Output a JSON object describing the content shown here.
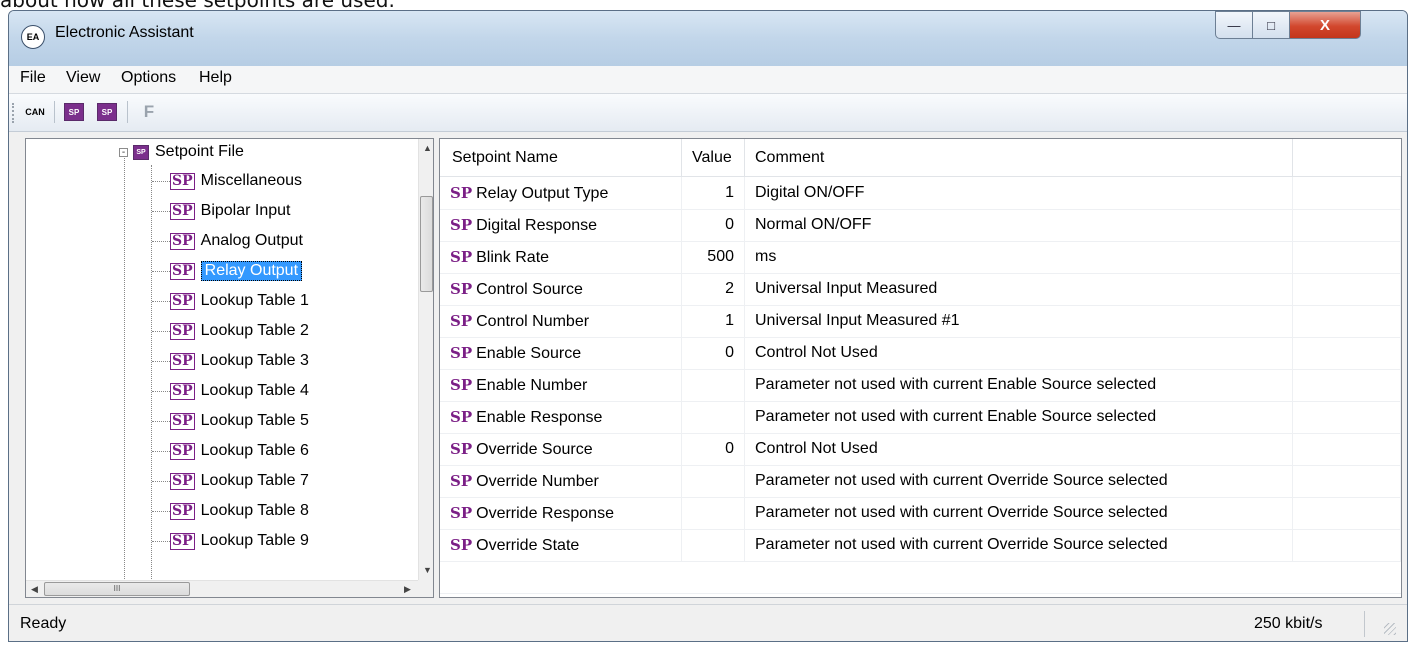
{
  "caption": "about how all these setpoints are used.",
  "window": {
    "title": "Electronic Assistant",
    "app_icon": "EA",
    "controls": {
      "minimize": "—",
      "maximize": "□",
      "close": "X"
    }
  },
  "menu": [
    "File",
    "View",
    "Options",
    "Help"
  ],
  "toolbar": {
    "can_label": "CAN",
    "sp1_label": "SP",
    "sp2_label": "SP",
    "f_label": "F",
    "icons": [
      "can-connect-icon",
      "open-setpoint-file-icon",
      "save-setpoint-file-icon",
      "flash-icon"
    ]
  },
  "tree": {
    "root": {
      "label": "Setpoint File",
      "expander": "-",
      "icon": "SP"
    },
    "sp_icon_label": "SP",
    "items": [
      {
        "label": "Miscellaneous"
      },
      {
        "label": "Bipolar Input"
      },
      {
        "label": "Analog Output"
      },
      {
        "label": "Relay Output",
        "selected": true
      },
      {
        "label": "Lookup Table 1"
      },
      {
        "label": "Lookup Table 2"
      },
      {
        "label": "Lookup Table 3"
      },
      {
        "label": "Lookup Table 4"
      },
      {
        "label": "Lookup Table 5"
      },
      {
        "label": "Lookup Table 6"
      },
      {
        "label": "Lookup Table 7"
      },
      {
        "label": "Lookup Table 8"
      },
      {
        "label": "Lookup Table 9"
      }
    ],
    "hscroll_grip": "III"
  },
  "grid": {
    "sp_tag": "SP",
    "headers": {
      "name": "Setpoint Name",
      "value": "Value",
      "comment": "Comment"
    },
    "rows": [
      {
        "name": "Relay Output Type",
        "value": "1",
        "comment": "Digital ON/OFF"
      },
      {
        "name": "Digital Response",
        "value": "0",
        "comment": "Normal ON/OFF"
      },
      {
        "name": "Blink Rate",
        "value": "500",
        "comment": "ms"
      },
      {
        "name": "Control Source",
        "value": "2",
        "comment": "Universal Input Measured"
      },
      {
        "name": "Control Number",
        "value": "1",
        "comment": "Universal Input Measured #1"
      },
      {
        "name": "Enable Source",
        "value": "0",
        "comment": "Control Not Used"
      },
      {
        "name": "Enable Number",
        "value": "",
        "comment": "Parameter not used with current Enable Source selected"
      },
      {
        "name": "Enable Response",
        "value": "",
        "comment": "Parameter not used with current Enable Source selected"
      },
      {
        "name": "Override Source",
        "value": "0",
        "comment": "Control Not Used"
      },
      {
        "name": "Override Number",
        "value": "",
        "comment": "Parameter not used with current Override Source selected"
      },
      {
        "name": "Override Response",
        "value": "",
        "comment": "Parameter not used with current Override Source selected"
      },
      {
        "name": "Override State",
        "value": "",
        "comment": "Parameter not used with current Override Source selected"
      }
    ]
  },
  "status": {
    "left": "Ready",
    "right": "250 kbit/s"
  },
  "colors": {
    "sp_purple": "#7b1f86",
    "selection": "#3399ff",
    "close_red": "#d2472d"
  }
}
